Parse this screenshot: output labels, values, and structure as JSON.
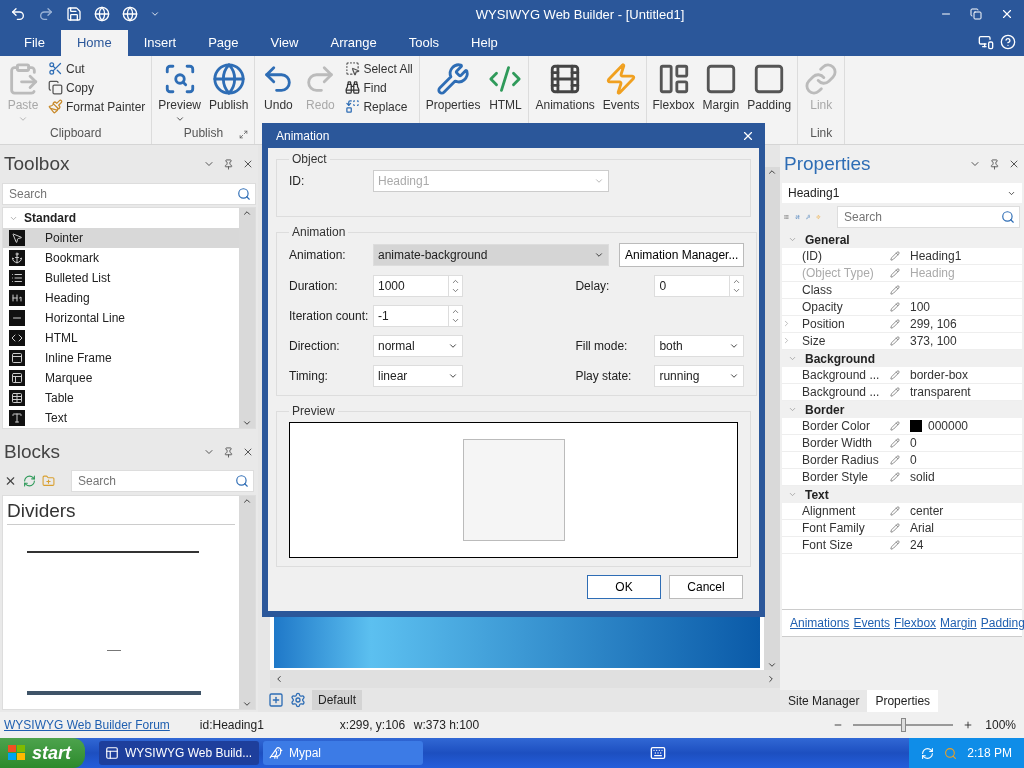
{
  "window": {
    "title": "WYSIWYG Web Builder - [Untitled1]"
  },
  "menu_tabs": [
    {
      "label": "File",
      "selected": false
    },
    {
      "label": "Home",
      "selected": true
    },
    {
      "label": "Insert",
      "selected": false
    },
    {
      "label": "Page",
      "selected": false
    },
    {
      "label": "View",
      "selected": false
    },
    {
      "label": "Arrange",
      "selected": false
    },
    {
      "label": "Tools",
      "selected": false
    },
    {
      "label": "Help",
      "selected": false
    }
  ],
  "ribbon": [
    {
      "label": "Clipboard",
      "large": [
        {
          "label": "Paste",
          "disabled": true,
          "dropdown": true
        }
      ],
      "small": [
        {
          "label": "Cut"
        },
        {
          "label": "Copy"
        },
        {
          "label": "Format Painter"
        }
      ]
    },
    {
      "label": "Publish",
      "launcher": true,
      "large": [
        {
          "label": "Preview",
          "disabled": false,
          "dropdown": true
        },
        {
          "label": "Publish",
          "disabled": false
        }
      ]
    },
    {
      "large": [
        {
          "label": "Undo",
          "disabled": false
        },
        {
          "label": "Redo",
          "disabled": true
        }
      ],
      "small": [
        {
          "label": "Select All"
        },
        {
          "label": "Find"
        },
        {
          "label": "Replace"
        }
      ]
    },
    {
      "large": [
        {
          "label": "Properties",
          "disabled": false
        },
        {
          "label": "HTML",
          "disabled": false
        }
      ]
    },
    {
      "large": [
        {
          "label": "Animations",
          "disabled": false
        },
        {
          "label": "Events",
          "disabled": false
        }
      ]
    },
    {
      "large": [
        {
          "label": "Flexbox",
          "disabled": false
        },
        {
          "label": "Margin",
          "disabled": false
        },
        {
          "label": "Padding",
          "disabled": false
        }
      ]
    },
    {
      "label": "Link",
      "large": [
        {
          "label": "Link",
          "disabled": true
        }
      ]
    }
  ],
  "toolbox": {
    "title": "Toolbox",
    "search": {
      "placeholder": "Search"
    },
    "category": {
      "label": "Standard",
      "expanded": true
    },
    "items": [
      {
        "label": "Pointer",
        "selected": true
      },
      {
        "label": "Bookmark",
        "selected": false
      },
      {
        "label": "Bulleted List",
        "selected": false
      },
      {
        "label": "Heading",
        "selected": false
      },
      {
        "label": "Horizontal Line",
        "selected": false
      },
      {
        "label": "HTML",
        "selected": false
      },
      {
        "label": "Inline Frame",
        "selected": false
      },
      {
        "label": "Marquee",
        "selected": false
      },
      {
        "label": "Table",
        "selected": false
      },
      {
        "label": "Text",
        "selected": false
      }
    ]
  },
  "blocks": {
    "title": "Blocks",
    "search": {
      "placeholder": "Search"
    },
    "category": "Dividers"
  },
  "canvas": {
    "tab": "Default"
  },
  "dialog": {
    "title": "Animation",
    "object": {
      "legend": "Object",
      "id_label": "ID:",
      "id_value": "Heading1",
      "disabled": true
    },
    "animation": {
      "legend": "Animation",
      "label": "Animation:",
      "value": "animate-background",
      "manager_button": "Animation Manager...",
      "rows": [
        {
          "left": {
            "label": "Duration:",
            "value": "1000",
            "kind": "spin"
          },
          "right": {
            "label": "Delay:",
            "value": "0",
            "kind": "spin"
          }
        },
        {
          "left": {
            "label": "Iteration count:",
            "value": "-1",
            "kind": "spin"
          }
        },
        {
          "left": {
            "label": "Direction:",
            "value": "normal",
            "kind": "combo"
          },
          "right": {
            "label": "Fill mode:",
            "value": "both",
            "kind": "combo"
          }
        },
        {
          "left": {
            "label": "Timing:",
            "value": "linear",
            "kind": "combo"
          },
          "right": {
            "label": "Play state:",
            "value": "running",
            "kind": "combo"
          }
        }
      ]
    },
    "preview": {
      "legend": "Preview"
    },
    "buttons": [
      {
        "label": "OK",
        "kind": "default"
      },
      {
        "label": "Cancel",
        "kind": "normal"
      }
    ]
  },
  "properties": {
    "title": "Properties",
    "object": "Heading1",
    "search": {
      "placeholder": "Search"
    },
    "groups": [
      {
        "label": "General",
        "expanded": true,
        "rows": [
          {
            "name": "(ID)",
            "value": "Heading1"
          },
          {
            "name": "(Object Type)",
            "value": "Heading",
            "disabled": true
          },
          {
            "name": "Class"
          },
          {
            "name": "Opacity",
            "value": "100"
          },
          {
            "name": "Position",
            "value": "299, 106",
            "expanded": false
          },
          {
            "name": "Size",
            "value": "373, 100",
            "expanded": false
          }
        ]
      },
      {
        "label": "Background",
        "expanded": true,
        "rows": [
          {
            "name": "Background ...",
            "value": "border-box"
          },
          {
            "name": "Background ...",
            "value": "transparent"
          }
        ]
      },
      {
        "label": "Border",
        "expanded": true,
        "rows": [
          {
            "name": "Border Color",
            "value": "000000",
            "color": "#000000"
          },
          {
            "name": "Border Width",
            "value": "0"
          },
          {
            "name": "Border Radius",
            "value": "0"
          },
          {
            "name": "Border Style",
            "value": "solid"
          }
        ]
      },
      {
        "label": "Text",
        "expanded": true,
        "rows": [
          {
            "name": "Alignment",
            "value": "center"
          },
          {
            "name": "Font Family",
            "value": "Arial"
          },
          {
            "name": "Font Size",
            "value": "24"
          }
        ]
      }
    ],
    "links": [
      "Animations",
      "Events",
      "Flexbox",
      "Margin",
      "Padding"
    ],
    "tabs": [
      {
        "label": "Site Manager",
        "selected": false
      },
      {
        "label": "Properties",
        "selected": true
      }
    ]
  },
  "status_bar": {
    "link": "WYSIWYG Web Builder Forum",
    "id": "id:Heading1",
    "position": "x:299, y:106",
    "size": "w:373 h:100",
    "zoom": {
      "level": 0.5,
      "reading": "100%"
    }
  },
  "taskbar": {
    "start": "start",
    "tasks": [
      {
        "label": "WYSIWYG Web Build...",
        "selected": true
      },
      {
        "label": "Mypal",
        "selected": false
      }
    ],
    "clock": "2:18 PM"
  }
}
